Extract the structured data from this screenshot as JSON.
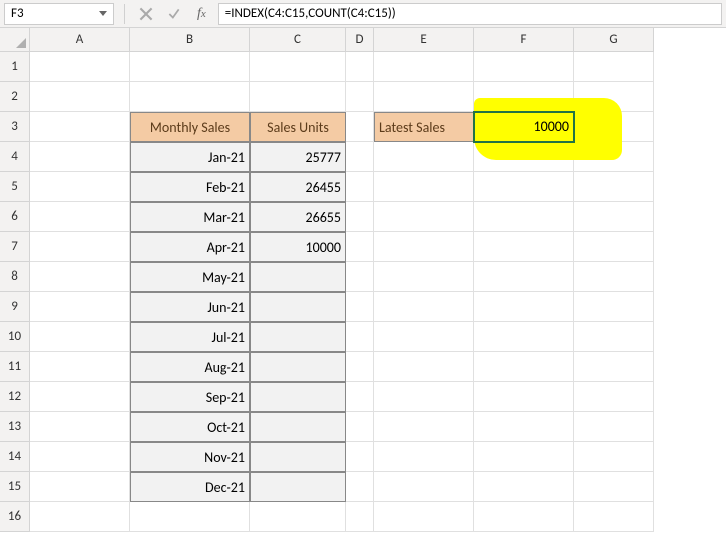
{
  "nameBox": "F3",
  "formula": "=INDEX(C4:C15,COUNT(C4:C15))",
  "columns": [
    "A",
    "B",
    "C",
    "D",
    "E",
    "F",
    "G"
  ],
  "rows": [
    "1",
    "2",
    "3",
    "4",
    "5",
    "6",
    "7",
    "8",
    "9",
    "10",
    "11",
    "12",
    "13",
    "14",
    "15",
    "16"
  ],
  "headers": {
    "monthlySales": "Monthly Sales",
    "salesUnits": "Sales Units",
    "latestSales": "Latest Sales"
  },
  "months": [
    "Jan-21",
    "Feb-21",
    "Mar-21",
    "Apr-21",
    "May-21",
    "Jun-21",
    "Jul-21",
    "Aug-21",
    "Sep-21",
    "Oct-21",
    "Nov-21",
    "Dec-21"
  ],
  "units": [
    "25777",
    "26455",
    "26655",
    "10000",
    "",
    "",
    "",
    "",
    "",
    "",
    "",
    ""
  ],
  "resultValue": "10000"
}
